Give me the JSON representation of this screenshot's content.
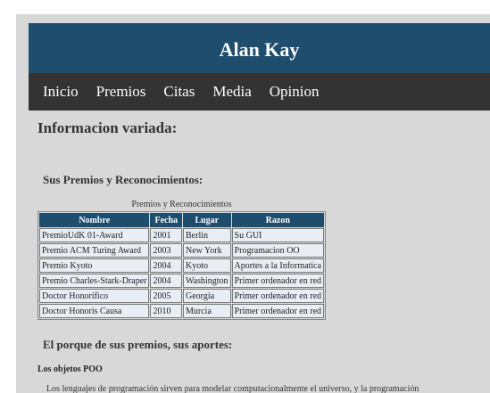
{
  "header": {
    "title": "Alan Kay"
  },
  "nav": {
    "items": [
      {
        "label": "Inicio"
      },
      {
        "label": "Premios"
      },
      {
        "label": "Citas"
      },
      {
        "label": "Media"
      },
      {
        "label": "Opinion"
      }
    ]
  },
  "main": {
    "section_title": "Informacion variada:",
    "awards_title": "Sus Premios y Reconocimientos:",
    "table": {
      "caption": "Premios y Reconocimientos",
      "headers": [
        "Nombre",
        "Fecha",
        "Lugar",
        "Razon"
      ],
      "rows": [
        [
          "PremioUdK 01-Award",
          "2001",
          "Berlin",
          "Su GUI"
        ],
        [
          "Premio ACM Turing Award",
          "2003",
          "New York",
          "Programacion OO"
        ],
        [
          "Premio Kyoto",
          "2004",
          "Kyoto",
          "Aportes a la Informatica"
        ],
        [
          "Premio Charles-Stark-Draper",
          "2004",
          "Washington",
          "Primer ordenador en red"
        ],
        [
          "Doctor Honorifico",
          "2005",
          "Georgia",
          "Primer ordenador en red"
        ],
        [
          "Doctor Honoris Causa",
          "2010",
          "Murcia",
          "Primer ordenador en red"
        ]
      ]
    },
    "reasons_title": "El porque de sus premios, sus aportes:",
    "objects_title": "Los objetos POO",
    "paragraph": "Los lenguajes de programación sirven para modelar computacionalmente el universo, y la programación"
  },
  "colors": {
    "header_bg": "#1e4d6e",
    "nav_bg": "#333333",
    "page_bg": "#d8d8d8"
  }
}
